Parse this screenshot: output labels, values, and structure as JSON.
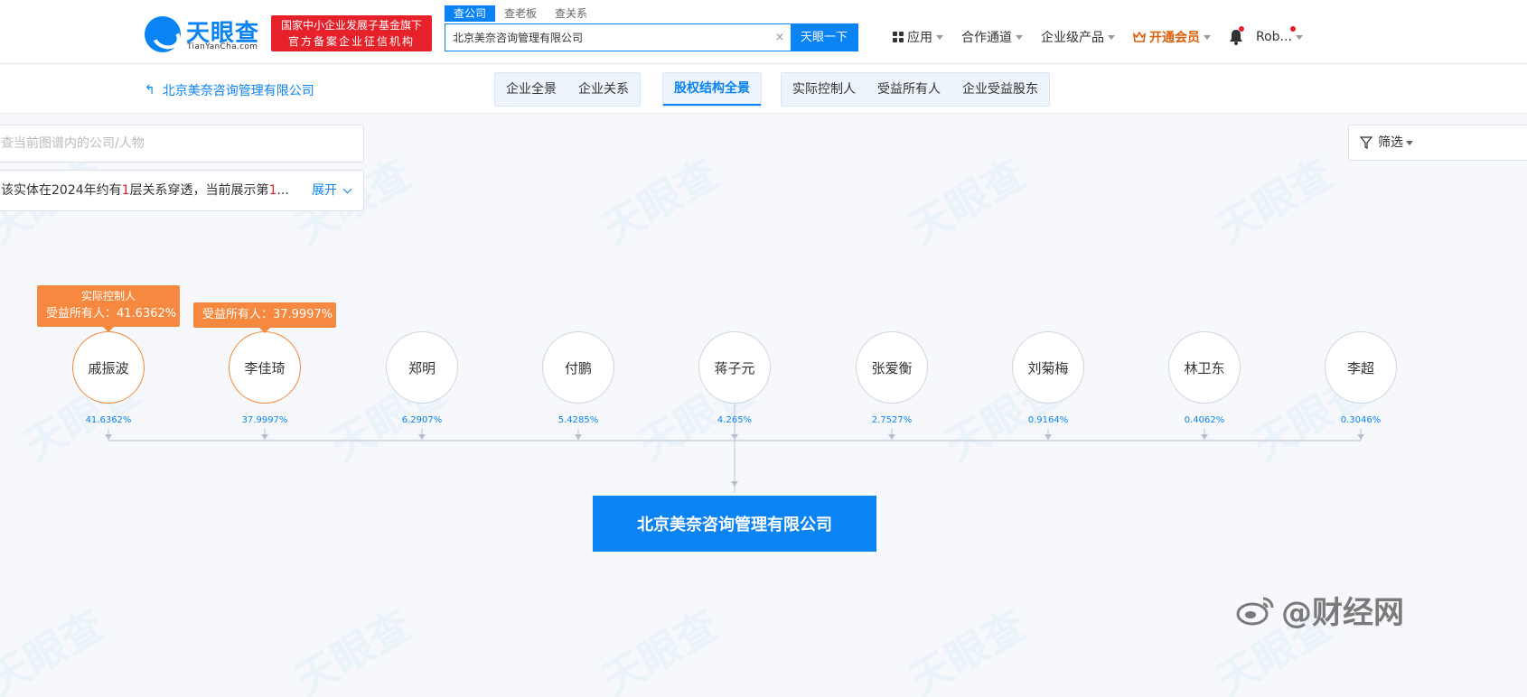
{
  "brand": {
    "name": "天眼查",
    "sub": "TianYanCha.com",
    "gov_line1": "国家中小企业发展子基金旗下",
    "gov_line2": "官方备案企业征信机构"
  },
  "search": {
    "tabs": [
      "查公司",
      "查老板",
      "查关系"
    ],
    "value": "北京美奈咨询管理有限公司",
    "clear": "×",
    "button": "天眼一下"
  },
  "nav": {
    "apps": "应用",
    "channel": "合作通道",
    "products": "企业级产品",
    "vip": "开通会员",
    "user": "Rob..."
  },
  "subbar": {
    "back_label": "北京美奈咨询管理有限公司",
    "tabs_group1": [
      "企业全景",
      "企业关系"
    ],
    "tabs_group2": [
      "股权结构全景"
    ],
    "tabs_group3": [
      "实际控制人",
      "受益所有人",
      "企业受益股东"
    ]
  },
  "graph": {
    "search_placeholder": "查当前图谱内的公司/人物",
    "notice_pre": "该实体在2024年约有",
    "notice_num1": "1",
    "notice_mid": "层关系穿透，当前展示第",
    "notice_num2": "1",
    "notice_post": "...",
    "expand": "展开",
    "filter": "筛选",
    "shareholders": [
      {
        "name": "戚振波",
        "pct": "41.6362%"
      },
      {
        "name": "李佳琦",
        "pct": "37.9997%"
      },
      {
        "name": "郑明",
        "pct": "6.2907%"
      },
      {
        "name": "付鹏",
        "pct": "5.4285%"
      },
      {
        "name": "蒋子元",
        "pct": "4.265%"
      },
      {
        "name": "张爱衡",
        "pct": "2.7527%"
      },
      {
        "name": "刘菊梅",
        "pct": "0.9164%"
      },
      {
        "name": "林卫东",
        "pct": "0.4062%"
      },
      {
        "name": "李超",
        "pct": "0.3046%"
      }
    ],
    "badge1_line1": "实际控制人",
    "badge1_line2": "受益所有人：41.6362%",
    "badge2_line1": "受益所有人：37.9997%",
    "company": "北京美奈咨询管理有限公司",
    "watermark": "天眼查",
    "weibo": "@财经网"
  },
  "colors": {
    "primary": "#0a83f5",
    "accent_orange": "#f6883f",
    "red": "#e62129"
  }
}
